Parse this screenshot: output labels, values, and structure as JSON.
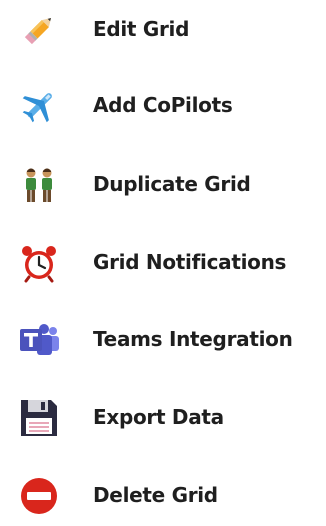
{
  "menu": {
    "items": [
      {
        "label": "Edit Grid",
        "icon": "pencil-icon"
      },
      {
        "label": "Add CoPilots",
        "icon": "airplane-icon"
      },
      {
        "label": "Duplicate Grid",
        "icon": "two-people-icon"
      },
      {
        "label": "Grid Notifications",
        "icon": "alarm-clock-icon"
      },
      {
        "label": "Teams Integration",
        "icon": "microsoft-teams-icon"
      },
      {
        "label": "Export Data",
        "icon": "floppy-disk-icon"
      },
      {
        "label": "Delete Grid",
        "icon": "no-entry-icon"
      }
    ]
  },
  "colors": {
    "label_text": "#1f1f1f",
    "pencil": "#f5a623",
    "airplane": "#2f8fd6",
    "people": "#3d8b3d",
    "clock": "#d9261c",
    "teams": "#4b53bc",
    "floppy": "#2b2b40",
    "delete": "#d9261c"
  }
}
